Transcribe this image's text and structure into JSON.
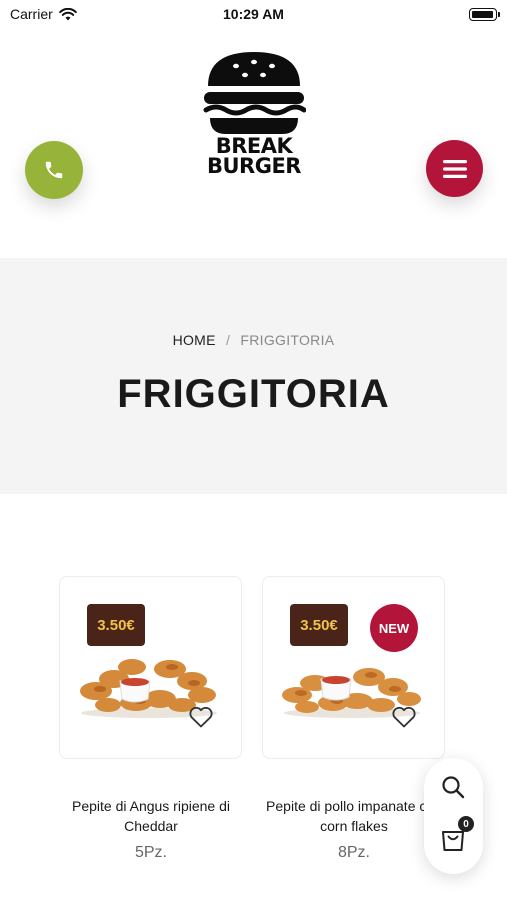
{
  "status_bar": {
    "carrier": "Carrier",
    "time": "10:29 AM"
  },
  "brand": {
    "line1": "BREAK",
    "line2": "BURGER"
  },
  "colors": {
    "phone": "#98b33a",
    "menu": "#b3153a",
    "badge_bg": "#4a2418",
    "badge_text": "#f1c24a"
  },
  "breadcrumb": {
    "home": "HOME",
    "separator": "/",
    "current": "FRIGGITORIA"
  },
  "page_title": "FRIGGITORIA",
  "products": [
    {
      "name": "Pepite di Angus ripiene di Cheddar",
      "price": "3.50€",
      "qty": "5Pz.",
      "badge": ""
    },
    {
      "name": "Pepite di pollo impanate con corn flakes",
      "price": "3.50€",
      "qty": "8Pz.",
      "badge": "NEW"
    }
  ],
  "cart": {
    "count": "0"
  },
  "icons": [
    "wifi-icon",
    "battery-icon",
    "phone-icon",
    "hamburger-menu-icon",
    "heart-icon",
    "search-icon",
    "shopping-bag-icon"
  ]
}
